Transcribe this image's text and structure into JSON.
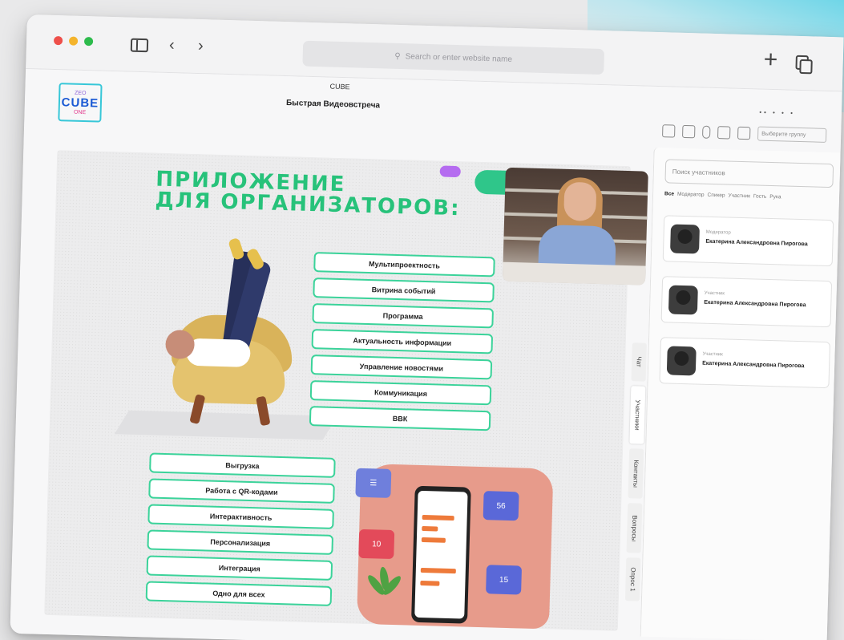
{
  "browser": {
    "url_placeholder": "Search or enter website name",
    "tab_title": "CUBE"
  },
  "app": {
    "logo": {
      "top": "ZEO",
      "main": "CUBE",
      "bottom": "ONE"
    },
    "meeting_title": "Быстрая Видеовстреча",
    "top_meta": "•• • • •",
    "role_select": "Выберите группу"
  },
  "slide": {
    "heading_line1": "ПРИЛОЖЕНИЕ",
    "heading_line2": "ДЛЯ ОРГАНИЗАТОРОВ:",
    "features_right": [
      "Мультипроектность",
      "Витрина событий",
      "Программа",
      "Актуальность информации",
      "Управление новостями",
      "Коммуникация",
      "ВВК"
    ],
    "features_left": [
      "Выгрузка",
      "Работа с QR-кодами",
      "Интерактивность",
      "Персонализация",
      "Интеграция",
      "Одно для всех"
    ],
    "phone_badges": {
      "like": "56",
      "heart": "10",
      "people": "15"
    }
  },
  "side_tabs": [
    "Чат",
    "Участники",
    "Контакты",
    "Вопросы",
    "Опрос 1"
  ],
  "participants": {
    "search_placeholder": "Поиск участников",
    "filters": [
      "Все",
      "Модератор",
      "Спикер",
      "Участник",
      "Гость",
      "Рука"
    ],
    "list": [
      {
        "role": "Модератор",
        "name": "Екатерина Александровна Пирогова"
      },
      {
        "role": "Участник",
        "name": "Екатерина Александровна Пирогова"
      },
      {
        "role": "Участник",
        "name": "Екатерина Александровна Пирогова"
      }
    ]
  },
  "colors": {
    "accent_green": "#27c27a",
    "logo_blue": "#1b5ad4",
    "coral": "#e79b8b"
  }
}
